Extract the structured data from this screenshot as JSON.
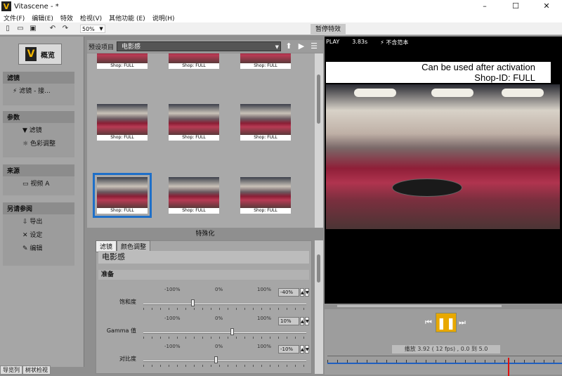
{
  "window": {
    "title": "Vitascene - *",
    "logo": "V",
    "minimize": "–",
    "maximize": "☐",
    "close": "✕"
  },
  "menu": [
    "文件(F)",
    "编辑(E)",
    "特效",
    "检视(V)",
    "其他功能 (E)",
    "说明(H)"
  ],
  "toolbar": {
    "zoom": "50%"
  },
  "sidebar": {
    "overview_label": "概览",
    "sections": [
      {
        "title": "滤镜",
        "items": [
          "滤镜 - 接..."
        ]
      },
      {
        "title": "参数",
        "items": [
          "滤镜",
          "色彩调整"
        ]
      },
      {
        "title": "来源",
        "items": [
          "视频 A"
        ]
      },
      {
        "title": "另请参阅",
        "items": [
          "导出",
          "设定",
          "编辑"
        ]
      }
    ],
    "bottom_tabs": [
      "导览列",
      "树状检视"
    ]
  },
  "presets": {
    "label": "预设项目",
    "selected": "电影感",
    "thumb_caption": "Shop: FULL",
    "footer": "特殊化"
  },
  "params": {
    "tabs": [
      "滤镜",
      "颜色调整"
    ],
    "title": "电影感",
    "group": "准备",
    "scale": [
      "-100%",
      "0%",
      "100%"
    ],
    "rows": [
      {
        "name": "饱和度",
        "value": "-40%",
        "level": -0.4
      },
      {
        "name": "Gamma 值",
        "value": "10%",
        "level": 0.1
      },
      {
        "name": "对比度",
        "value": "-10%",
        "level": -0.1
      }
    ]
  },
  "preview": {
    "tab": "暂停特效",
    "play": "PLAY",
    "time": "3.83s",
    "sample": "⚡ 不含范本",
    "watermark_line1": "Can be used after activation",
    "watermark_line2": "Shop-ID:  FULL",
    "status": "播放  3.92 ( 12 fps) ,  0.0 到 5.0"
  }
}
